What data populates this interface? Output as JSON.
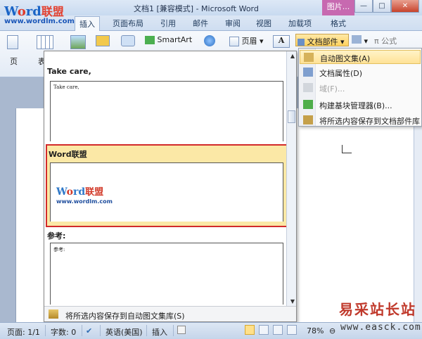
{
  "window": {
    "title": "文档1 [兼容模式] - Microsoft Word",
    "context_tab_header": "图片...",
    "minimize": "—",
    "maximize": "□",
    "close": "✕"
  },
  "logo": {
    "w": "W",
    "o": "o",
    "rd": "rd",
    "cn": "联盟",
    "url": "www.wordlm.com"
  },
  "ribbon_tabs": [
    {
      "label": "插入",
      "active": true
    },
    {
      "label": "页面布局"
    },
    {
      "label": "引用"
    },
    {
      "label": "邮件"
    },
    {
      "label": "审阅"
    },
    {
      "label": "视图"
    },
    {
      "label": "加载项"
    },
    {
      "label": "格式"
    }
  ],
  "ribbon": {
    "page_label": "页",
    "table_label": "表",
    "smartart_label": "SmartArt",
    "header_label": "页眉",
    "textbox_label": "A",
    "docparts_label": "文档部件",
    "formula_label": "π 公式"
  },
  "gallery": {
    "items": [
      {
        "title": "Take care,",
        "preview": "Take care,"
      },
      {
        "title": "Word联盟",
        "selected": true,
        "preview_logo": {
          "w": "W",
          "o": "o",
          "rd": "rd",
          "cn": "联盟",
          "url": "www.wordlm.com"
        }
      },
      {
        "title": "参考:",
        "preview": "参考:"
      }
    ],
    "footer": "将所选内容保存到自动图文集库(S)"
  },
  "menu": {
    "items": [
      {
        "label": "自动图文集(A)",
        "highlighted": true,
        "icon": "autotext-icon",
        "has_submenu": true
      },
      {
        "label": "文档属性(D)",
        "icon": "doc-properties-icon",
        "has_submenu": true
      },
      {
        "label": "域(F)...",
        "icon": "field-icon",
        "disabled": true
      },
      {
        "label": "构建基块管理器(B)...",
        "icon": "building-blocks-icon"
      },
      {
        "label": "将所选内容保存到文档部件库(S)",
        "icon": "save-selection-icon"
      }
    ]
  },
  "statusbar": {
    "page": "页面: 1/1",
    "words": "字数: 0",
    "language": "英语(美国)",
    "mode": "插入",
    "zoom": "78%"
  },
  "watermark": {
    "cn": "易采站长站",
    "url": "www.easck.com"
  }
}
